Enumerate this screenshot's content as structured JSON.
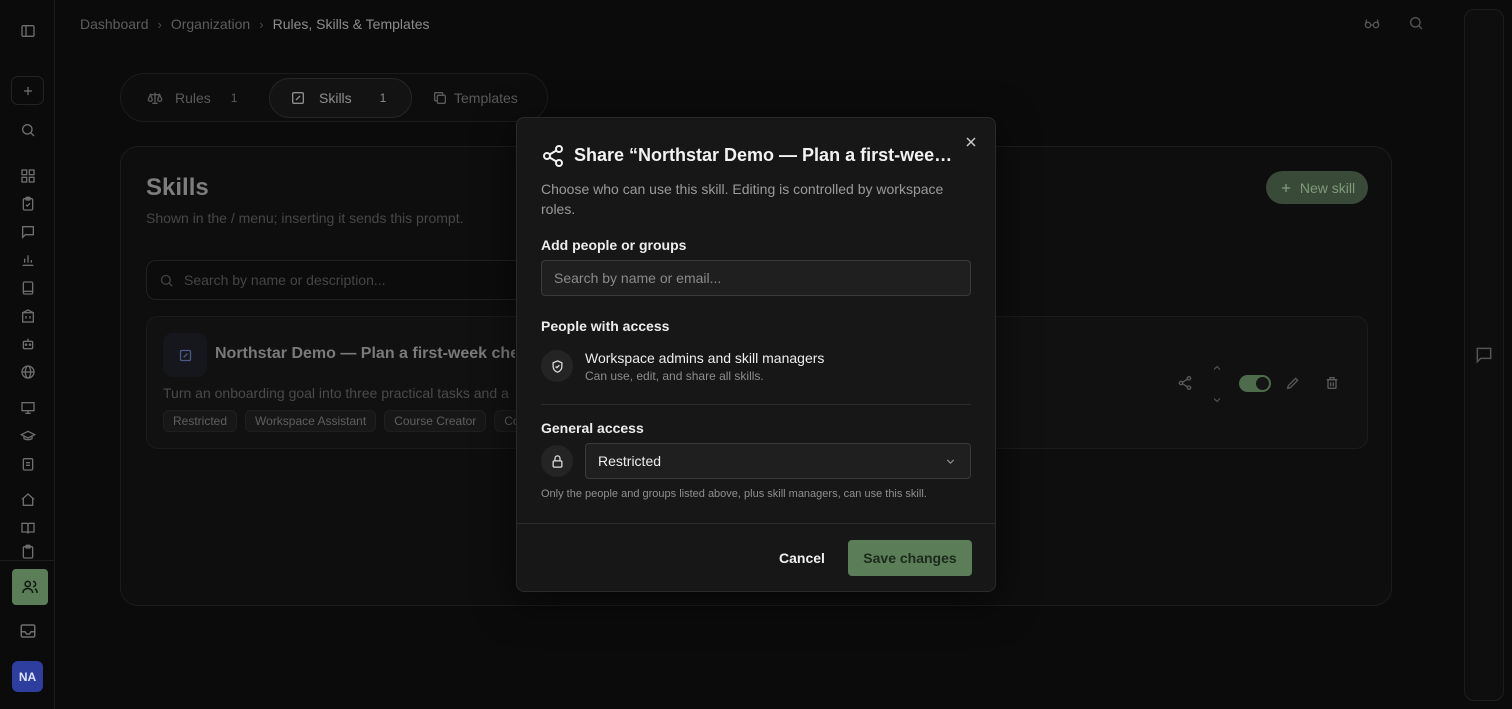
{
  "breadcrumb": {
    "items": [
      "Dashboard",
      "Organization"
    ],
    "current": "Rules, Skills & Templates"
  },
  "tabs": [
    {
      "label": "Rules",
      "count": "1",
      "icon": "scale-icon"
    },
    {
      "label": "Skills",
      "count": "1",
      "icon": "edit-square-icon"
    },
    {
      "label": "Templates",
      "icon": "copy-icon"
    }
  ],
  "page": {
    "title": "Skills",
    "subtitle": "Shown in the / menu; inserting it sends this prompt.",
    "new_button": "New skill",
    "search_placeholder": "Search by name or description..."
  },
  "skill": {
    "title": "Northstar Demo — Plan a first-week checklist",
    "description": "Turn an onboarding goal into three practical tasks and a",
    "tags": [
      "Restricted",
      "Workspace Assistant",
      "Course Creator",
      "Co"
    ],
    "enabled": true
  },
  "sidebar": {
    "avatar": "NA"
  },
  "modal": {
    "title": "Share “Northstar Demo — Plan a first-week checklist”",
    "description": "Choose who can use this skill. Editing is controlled by workspace roles.",
    "add_label": "Add people or groups",
    "add_placeholder": "Search by name or email...",
    "people_label": "People with access",
    "access_name": "Workspace admins and skill managers",
    "access_sub": "Can use, edit, and share all skills.",
    "general_label": "General access",
    "general_value": "Restricted",
    "general_help": "Only the people and groups listed above, plus skill managers, can use this skill.",
    "cancel": "Cancel",
    "save": "Save changes"
  },
  "colors": {
    "accent": "#5b7e58",
    "avatar": "#2d3e9e",
    "background": "#0b0b0b",
    "modal": "#171717"
  }
}
